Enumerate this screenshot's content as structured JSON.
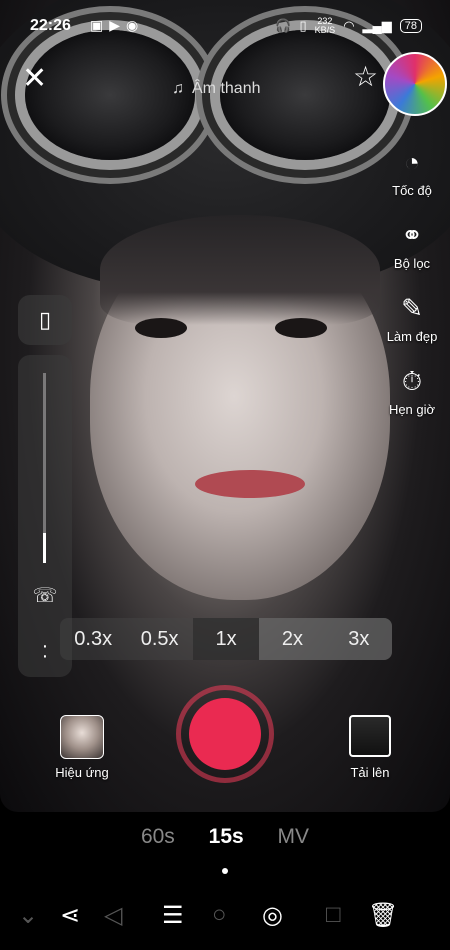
{
  "status_bar": {
    "time": "22:26",
    "network_speed": "232",
    "network_unit": "KB/S",
    "battery": "78"
  },
  "top": {
    "sound_label": "Âm thanh"
  },
  "tools": [
    {
      "label": "Tốc độ",
      "icon": "speed-icon"
    },
    {
      "label": "Bộ lọc",
      "icon": "filter-icon"
    },
    {
      "label": "Làm đẹp",
      "icon": "beauty-wand-icon"
    },
    {
      "label": "Hẹn giờ",
      "icon": "timer-icon"
    }
  ],
  "zoom": {
    "options": [
      "0.3x",
      "0.5x",
      "1x",
      "2x",
      "3x"
    ],
    "selected": "1x"
  },
  "effects": {
    "label": "Hiệu ứng"
  },
  "upload": {
    "label": "Tải lên"
  },
  "modes": {
    "items": [
      "60s",
      "15s",
      "MV"
    ],
    "selected": "15s"
  },
  "colors": {
    "record": "#ea2a51",
    "background": "#000000"
  }
}
